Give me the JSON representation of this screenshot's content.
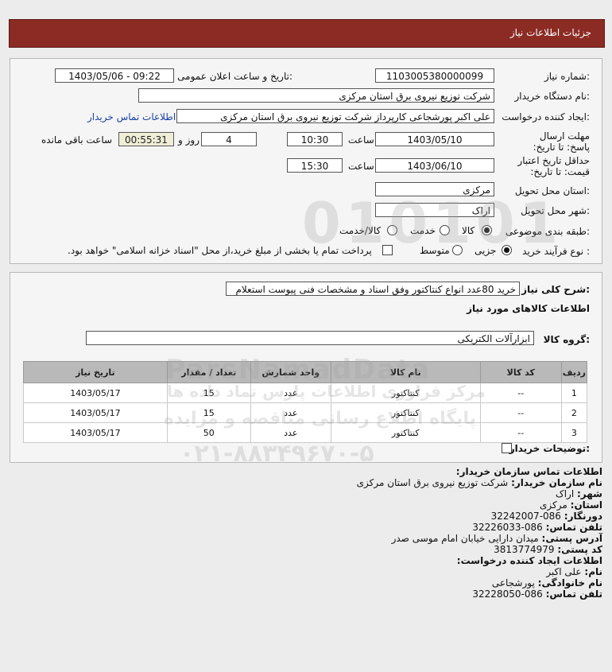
{
  "header": {
    "title": "جزئیات اطلاعات نیاز"
  },
  "form": {
    "need_number_label": "شماره نیاز:",
    "need_number": "1103005380000099",
    "announce_label": "تاریخ و ساعت اعلان عمومی:",
    "announce_value": "1403/05/06 - 09:22",
    "buyer_org_label": "نام دستگاه خریدار:",
    "buyer_org": "شرکت توزیع نیروی برق استان مرکزی",
    "creator_label": "ایجاد کننده درخواست:",
    "creator": "علی اکبر پورشجاعی کارپرداز شرکت توزیع نیروی برق استان مرکزی",
    "contact_link": "اطلاعات تماس خریدار",
    "deadline_label": "مهلت ارسال پاسخ: تا تاریخ:",
    "deadline_date": "1403/05/10",
    "time_label": "ساعت",
    "deadline_time": "10:30",
    "days_label": "روز و",
    "days": "4",
    "remaining_label": "ساعت باقی مانده",
    "remaining": "00:55:31",
    "validity_label": "حداقل تاریخ اعتبار قیمت: تا تاریخ:",
    "validity_date": "1403/06/10",
    "validity_time": "15:30",
    "province_label": "استان محل تحویل:",
    "province": "مرکزی",
    "city_label": "شهر محل تحویل:",
    "city": "اراک",
    "category_label": "طبقه بندی موضوعی:",
    "category_options": [
      "کالا",
      "خدمت",
      "کالا/خدمت"
    ],
    "process_label": "نوع فرآیند خرید :",
    "process_options": [
      "جزیی",
      "متوسط"
    ],
    "payment_note": "پرداخت تمام یا بخشی از مبلغ خرید،از محل \"اسناد خزانه اسلامی\" خواهد بود."
  },
  "description": {
    "label": "شرح کلی نیاز:",
    "value": "خرید 80عدد انواع کنتاکتور وفق اسناد و مشخصات فنی پیوست استعلام",
    "goods_info_title": "اطلاعات کالاهای مورد نیاز",
    "group_label": "گروه کالا:",
    "group_value": "ابزارآلات الکتریکی"
  },
  "table": {
    "headers": [
      "ردیف",
      "کد کالا",
      "نام کالا",
      "واحد شمارش",
      "تعداد / مقدار",
      "تاریخ نیاز"
    ],
    "rows": [
      [
        "1",
        "--",
        "کنتاکتور",
        "عدد",
        "15",
        "1403/05/17"
      ],
      [
        "2",
        "--",
        "کنتاکتور",
        "عدد",
        "15",
        "1403/05/17"
      ],
      [
        "3",
        "--",
        "کنتاکتور",
        "عدد",
        "50",
        "1403/05/17"
      ]
    ]
  },
  "buyer_notes_label": "توضیحات خریدار:",
  "contact": {
    "title": "اطلاعات تماس سازمان خریدار:",
    "org_label": "نام سازمان خریدار:",
    "org": "شرکت توزیع نیروی برق استان مرکزی",
    "city_label": "شهر:",
    "city": "اراک",
    "province_label": "استان:",
    "province": "مرکزی",
    "fax_label": "دورنگار:",
    "fax": "086-32242007",
    "phone_label": "تلفن تماس:",
    "phone": "086-32226033",
    "address_label": "آدرس پستی:",
    "address": "میدان دارایی خیابان امام موسی صدر",
    "postal_label": "کد پستی:",
    "postal": "3813774979",
    "creator_title": "اطلاعات ایجاد کننده درخواست:",
    "name_label": "نام:",
    "name": "علی اکبر",
    "family_label": "نام خانوادگی:",
    "family": "پورشجاعی",
    "cphone_label": "تلفن تماس:",
    "cphone": "086-32228050"
  },
  "watermark": {
    "brand": "ParsNamadData",
    "line1": "مرکز فراوری اطلاعات پارس نماد داده ها",
    "line2": "پایگاه اطلاع رسانی مناقصه و مزایده",
    "phone": "۰۲۱-۸۸۳۴۹۶۷۰-۵"
  }
}
